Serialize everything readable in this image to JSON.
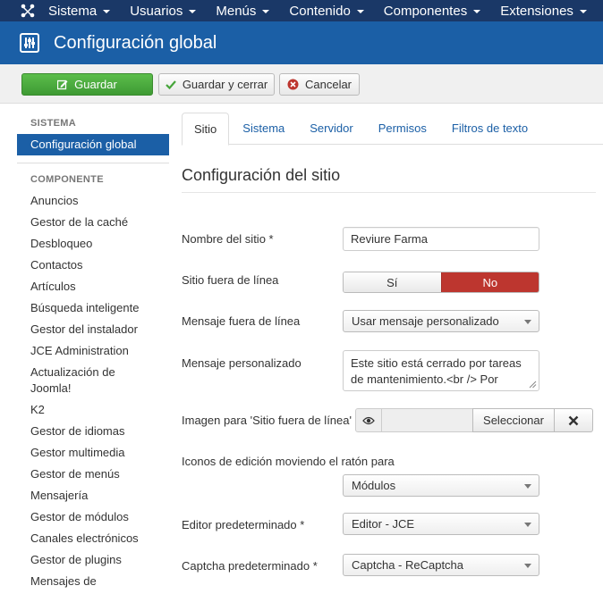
{
  "navbar": {
    "menu": [
      {
        "label": "Sistema"
      },
      {
        "label": "Usuarios"
      },
      {
        "label": "Menús"
      },
      {
        "label": "Contenido"
      },
      {
        "label": "Componentes"
      },
      {
        "label": "Extensiones"
      }
    ]
  },
  "header": {
    "title": "Configuración global"
  },
  "toolbar": {
    "save_label": "Guardar",
    "save_close_label": "Guardar y cerrar",
    "cancel_label": "Cancelar"
  },
  "sidebar": {
    "system_heading": "SISTEMA",
    "system_item": "Configuración global",
    "component_heading": "COMPONENTE",
    "items": [
      "Anuncios",
      "Gestor de la caché",
      "Desbloqueo",
      "Contactos",
      "Artículos",
      "Búsqueda inteligente",
      "Gestor del instalador",
      "JCE Administration",
      "Actualización de Joomla!",
      "K2",
      "Gestor de idiomas",
      "Gestor multimedia",
      "Gestor de menús",
      "Mensajería",
      "Gestor de módulos",
      "Canales electrónicos",
      "Gestor de plugins",
      "Mensajes de"
    ]
  },
  "tabs": [
    {
      "label": "Sitio",
      "active": true
    },
    {
      "label": "Sistema"
    },
    {
      "label": "Servidor"
    },
    {
      "label": "Permisos"
    },
    {
      "label": "Filtros de texto"
    }
  ],
  "section_title": "Configuración del sitio",
  "form": {
    "site_name": {
      "label": "Nombre del sitio *",
      "value": "Reviure Farma"
    },
    "offline": {
      "label": "Sitio fuera de línea",
      "yes": "Sí",
      "no": "No",
      "selected": "No"
    },
    "offline_message": {
      "label": "Mensaje fuera de línea",
      "value": "Usar mensaje personalizado"
    },
    "custom_message": {
      "label": "Mensaje personalizado",
      "value": "Este sitio está cerrado por tareas de mantenimiento.<br /> Por"
    },
    "offline_image": {
      "label": "Imagen para 'Sitio fuera de línea'",
      "select_label": "Seleccionar"
    },
    "hover_icons": {
      "label": "Iconos de edición moviendo el ratón para",
      "value": "Módulos"
    },
    "default_editor": {
      "label": "Editor predeterminado *",
      "value": "Editor - JCE"
    },
    "default_captcha": {
      "label": "Captcha predeterminado *",
      "value": "Captcha - ReCaptcha"
    }
  },
  "colors": {
    "navbar": "#1a3867",
    "header": "#1b5fa6",
    "save": "#46a53a",
    "toggle_no": "#bd362f"
  }
}
